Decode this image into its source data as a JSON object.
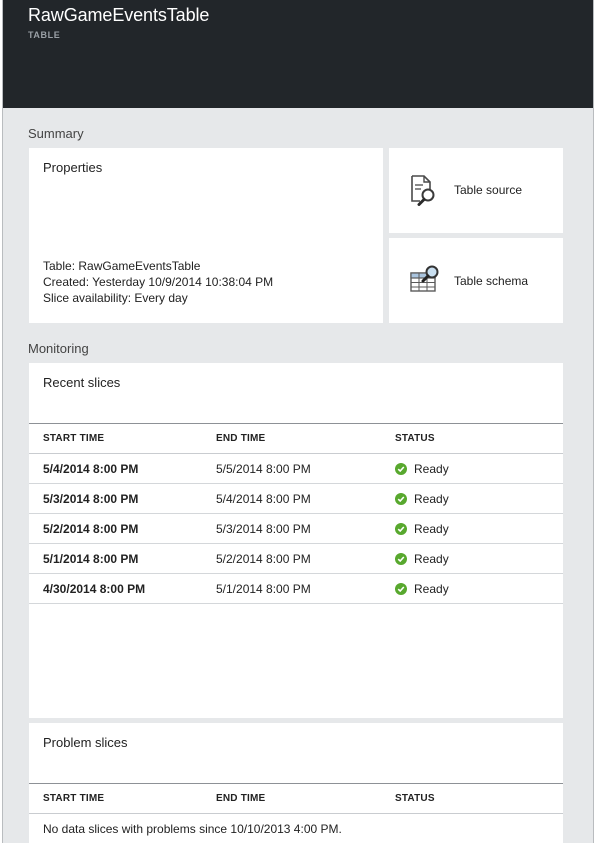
{
  "header": {
    "title": "RawGameEventsTable",
    "subtitle": "TABLE"
  },
  "summary": {
    "label": "Summary",
    "properties": {
      "title": "Properties",
      "table": "Table: RawGameEventsTable",
      "created": "Created: Yesterday 10/9/2014 10:38:04 PM",
      "slice_availability": "Slice availability: Every day"
    },
    "tiles": [
      {
        "label": "Table source",
        "icon": "document-search-icon"
      },
      {
        "label": "Table schema",
        "icon": "table-search-icon"
      }
    ]
  },
  "monitoring": {
    "label": "Monitoring",
    "recent": {
      "title": "Recent slices",
      "columns": [
        "START TIME",
        "END TIME",
        "STATUS"
      ],
      "rows": [
        {
          "start": "5/4/2014 8:00 PM",
          "end": "5/5/2014 8:00 PM",
          "status": "Ready"
        },
        {
          "start": "5/3/2014 8:00 PM",
          "end": "5/4/2014 8:00 PM",
          "status": "Ready"
        },
        {
          "start": "5/2/2014 8:00 PM",
          "end": "5/3/2014 8:00 PM",
          "status": "Ready"
        },
        {
          "start": "5/1/2014 8:00 PM",
          "end": "5/2/2014 8:00 PM",
          "status": "Ready"
        },
        {
          "start": "4/30/2014 8:00 PM",
          "end": "5/1/2014 8:00 PM",
          "status": "Ready"
        }
      ],
      "status_color": "#58a82e"
    },
    "problem": {
      "title": "Problem slices",
      "columns": [
        "START TIME",
        "END TIME",
        "STATUS"
      ],
      "empty_message": "No data slices with problems since 10/10/2013 4:00 PM."
    }
  }
}
